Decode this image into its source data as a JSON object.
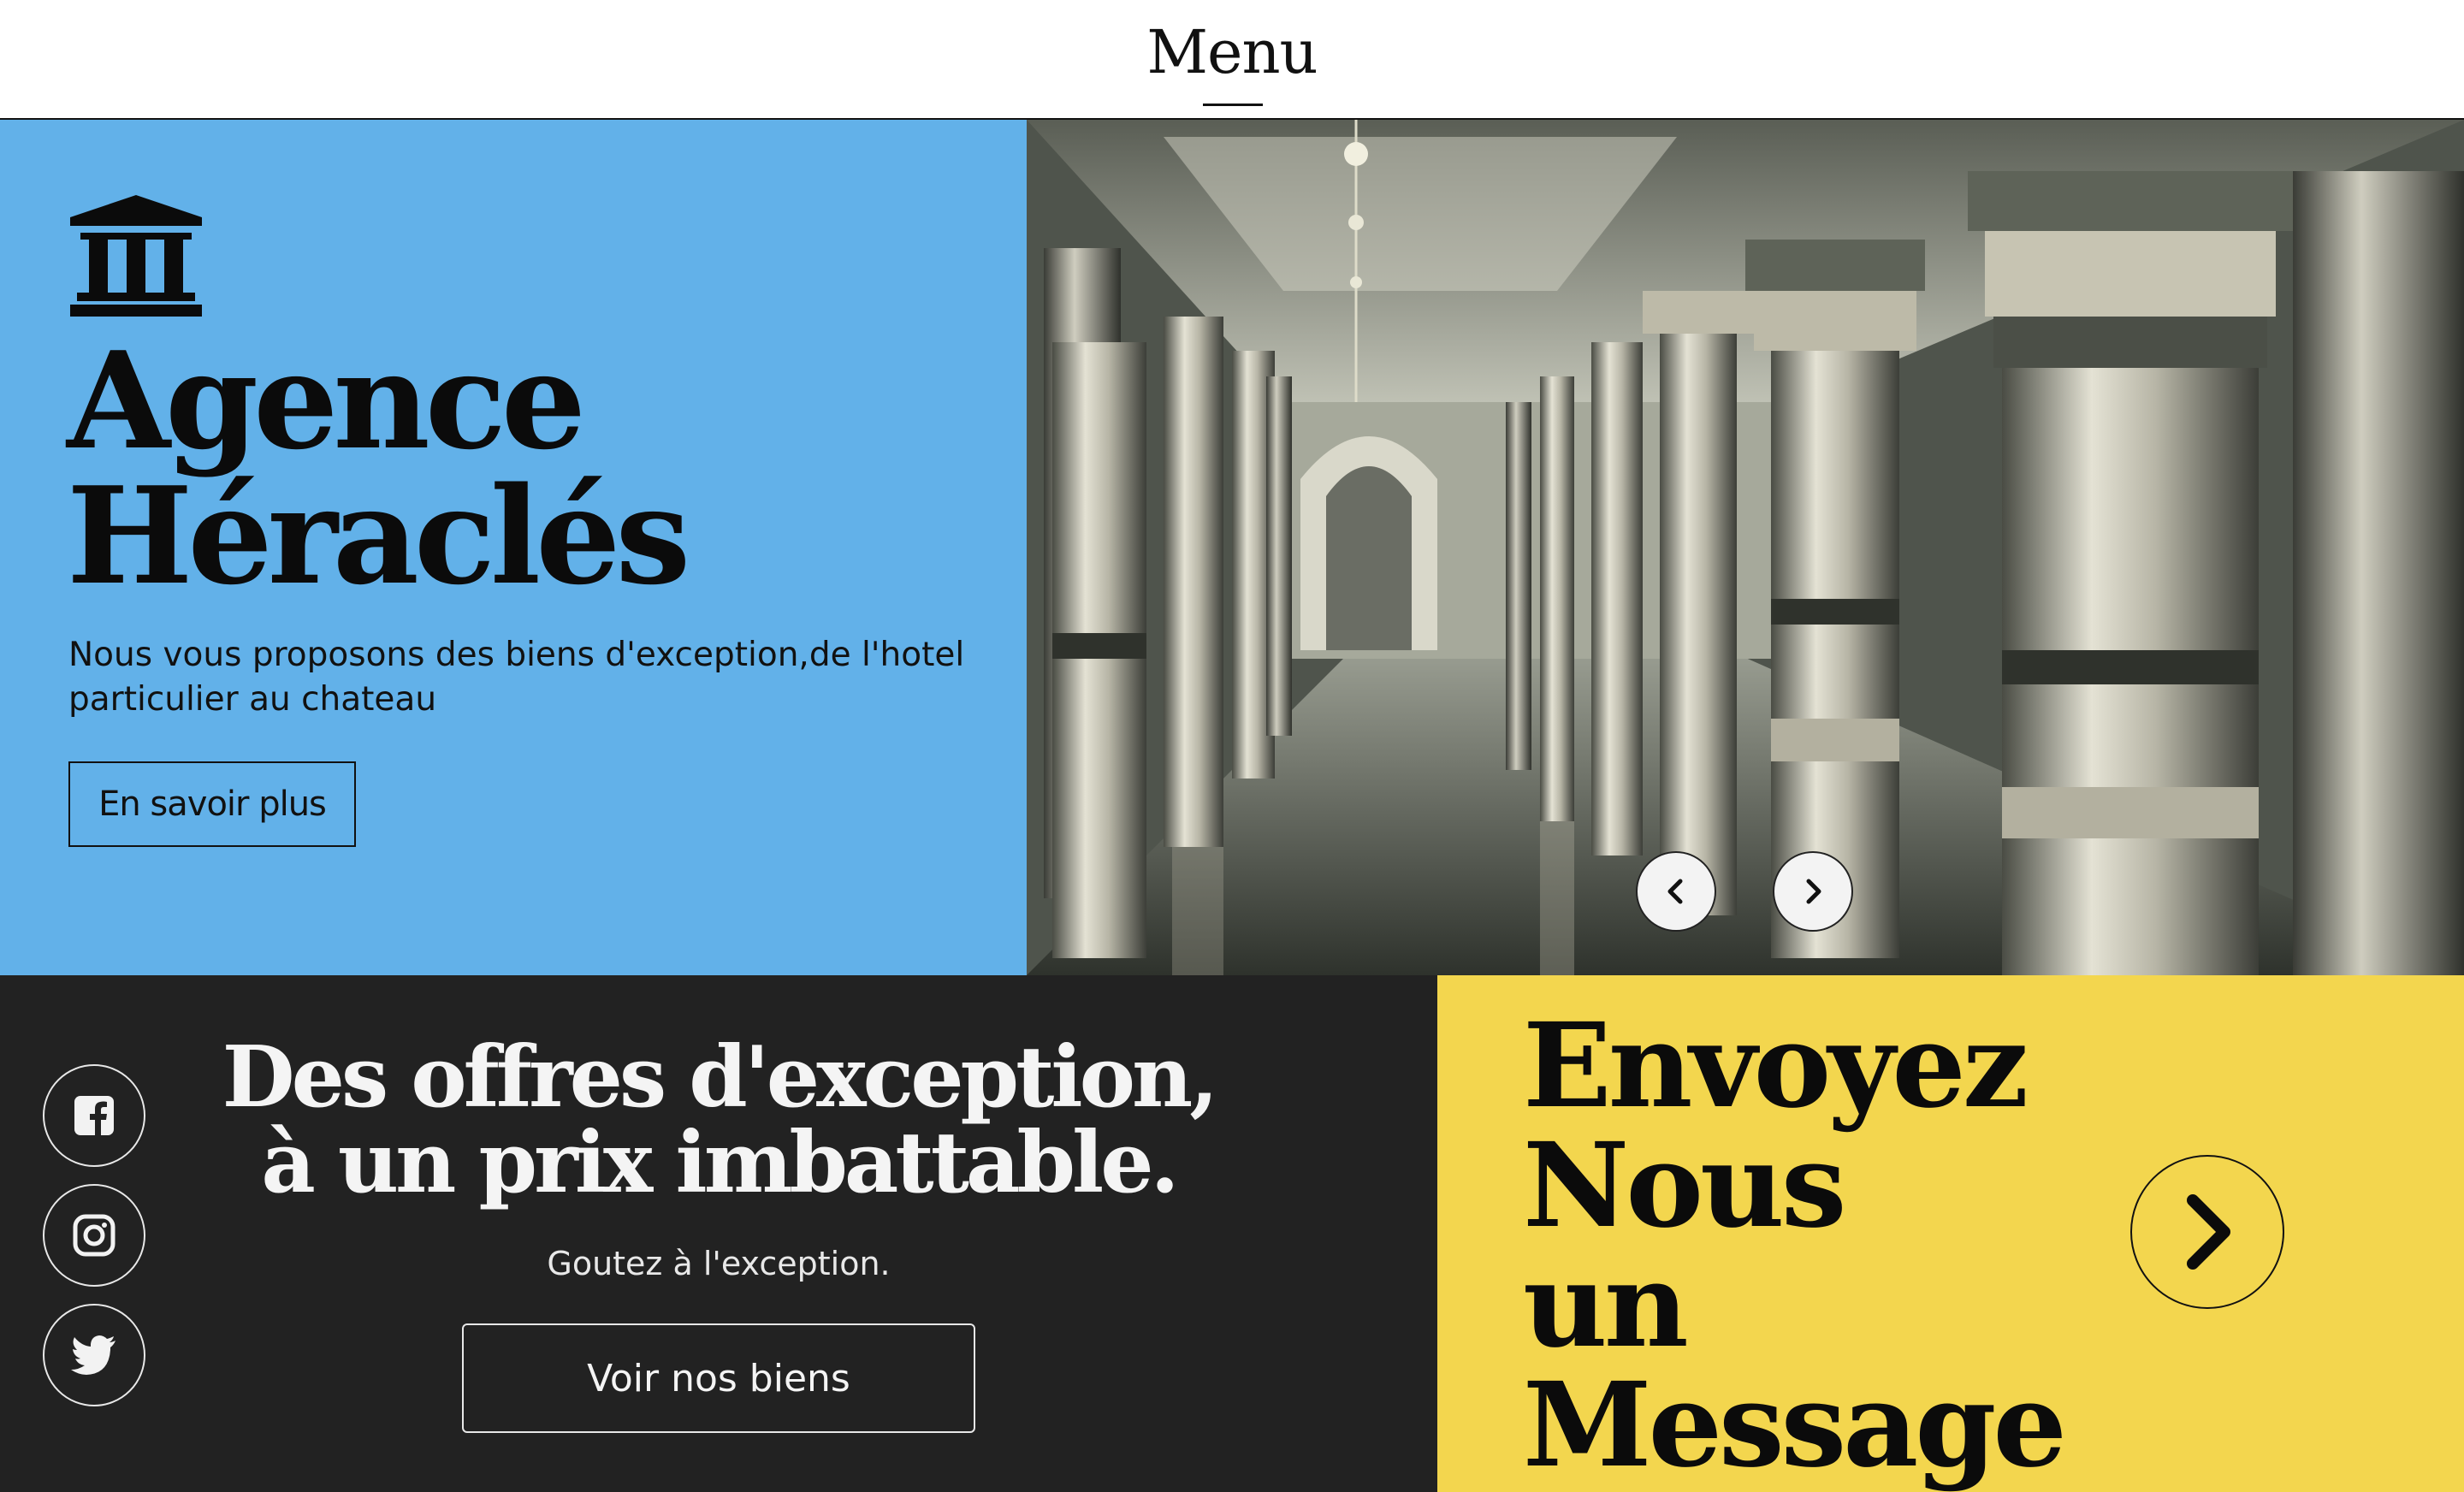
{
  "header": {
    "menu_label": "Menu"
  },
  "hero": {
    "icon": "bank-icon",
    "title_line1": "Agence",
    "title_line2": "Héraclés",
    "description": "Nous vous proposons des biens d'exception,de l'hotel particulier au chateau",
    "button_label": "En savoir plus",
    "background_color": "#62b1e9"
  },
  "carousel": {
    "image": "palace-columns-hallway",
    "prev_icon": "chevron-left-icon",
    "next_icon": "chevron-right-icon"
  },
  "offers": {
    "title_line1": "Des offres d'exception,",
    "title_line2": "à un prix imbattable.",
    "subtitle": "Goutez à l'exception.",
    "button_label": "Voir nos biens",
    "background_color": "#222222"
  },
  "social": [
    {
      "icon": "facebook-icon"
    },
    {
      "icon": "instagram-icon"
    },
    {
      "icon": "twitter-icon"
    }
  ],
  "contact": {
    "line1": "Envoyez",
    "line2": "Nous",
    "line3": "un",
    "line4": "Message",
    "arrow_icon": "chevron-right-icon",
    "background_color": "#f3d64e"
  }
}
